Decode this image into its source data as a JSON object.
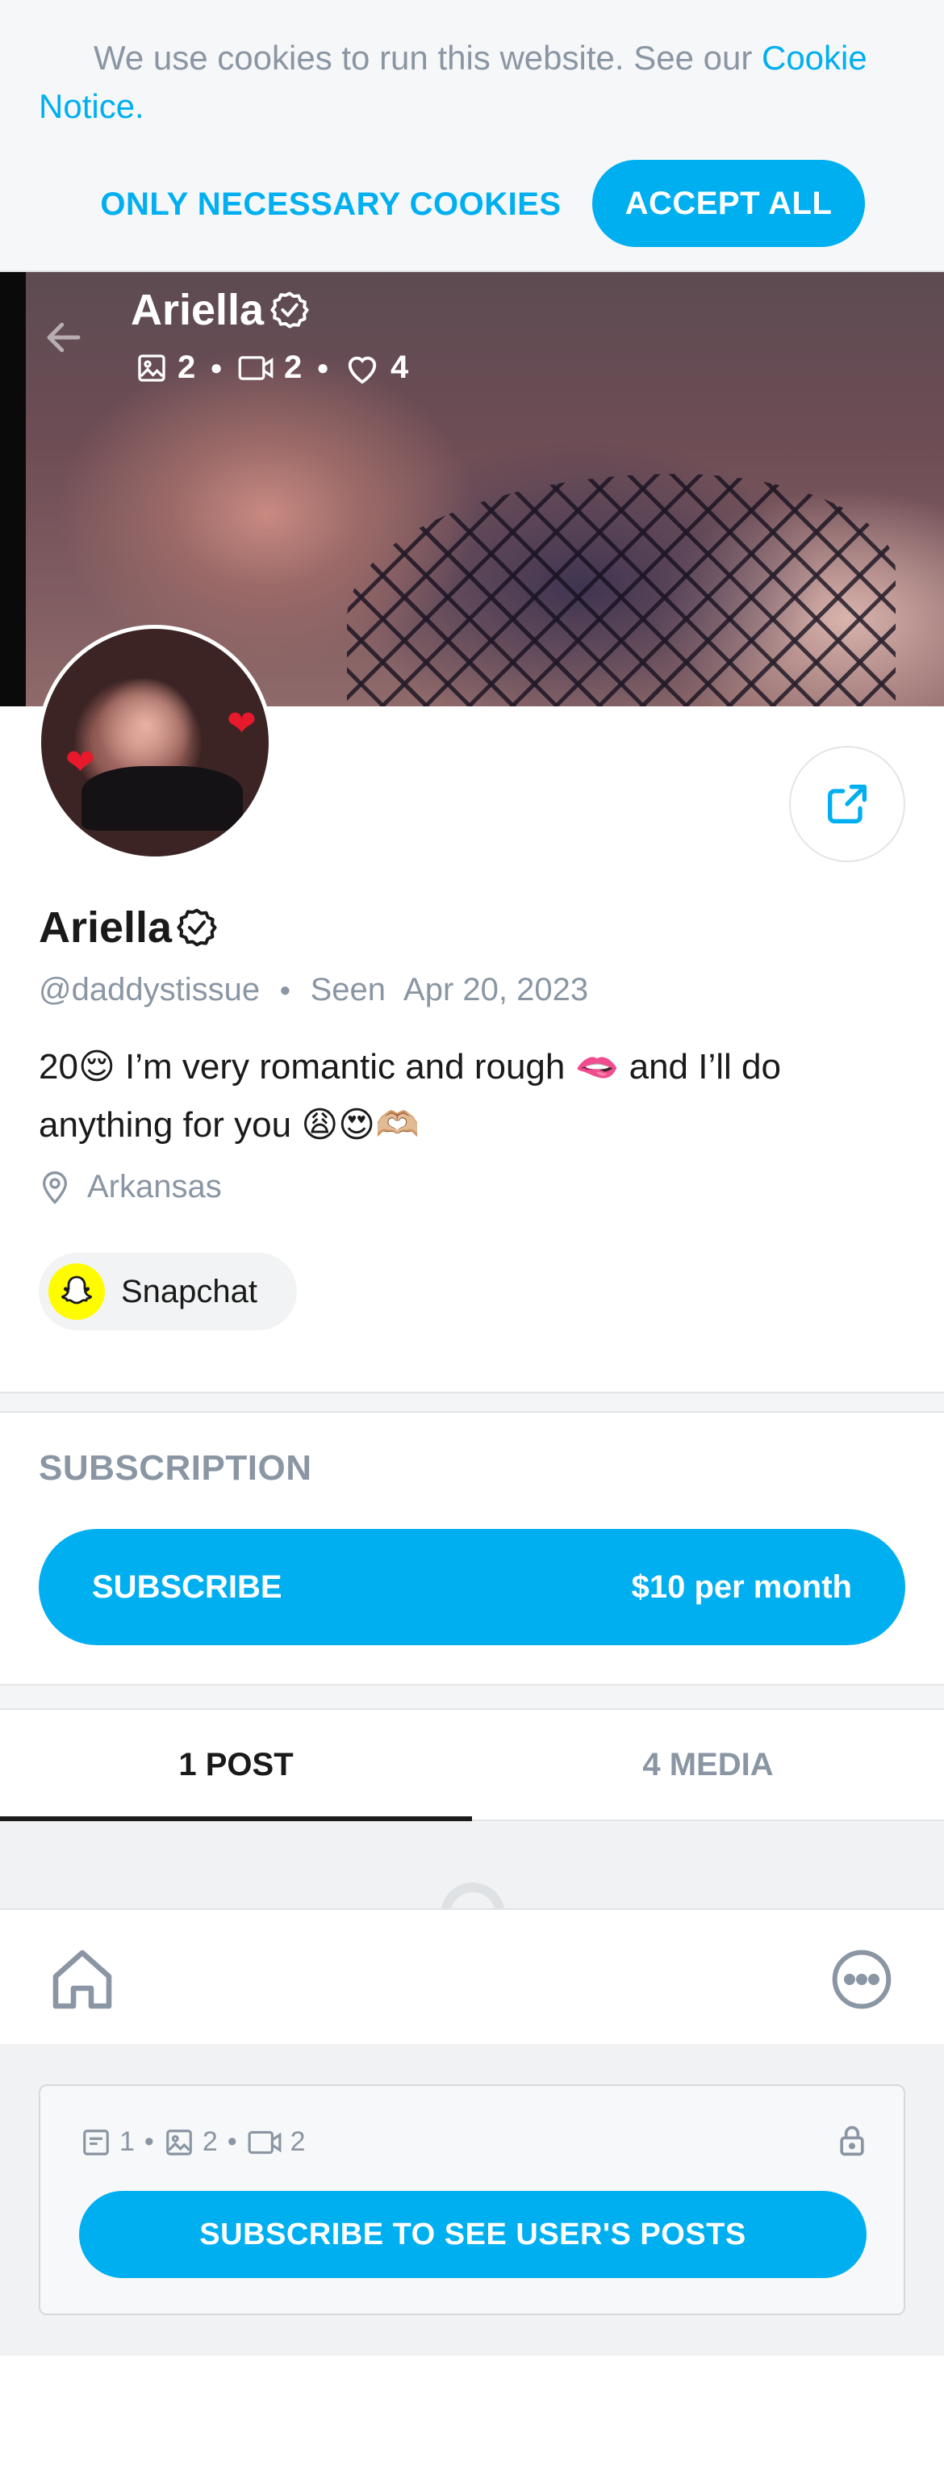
{
  "cookie_banner": {
    "text": "We use cookies to run this website. See our ",
    "link": "Cookie Notice.",
    "necessary_label": "ONLY NECESSARY COOKIES",
    "accept_label": "ACCEPT ALL"
  },
  "cover": {
    "name": "Ariella",
    "photos": "2",
    "videos": "2",
    "likes": "4"
  },
  "profile": {
    "name": "Ariella",
    "username": "@daddystissue",
    "seen_label": "Seen",
    "seen_date": "Apr 20, 2023",
    "bio": "20😌 I’m very romantic and rough 🫦 and I’ll do anything for you 😩😍🫶🏼",
    "location": "Arkansas",
    "social_label": "Snapchat"
  },
  "subscription": {
    "title": "SUBSCRIPTION",
    "button_label": "SUBSCRIBE",
    "price": "$10 per month"
  },
  "tabs": [
    {
      "label": "1 POST",
      "active": true
    },
    {
      "label": "4 MEDIA",
      "active": false
    }
  ],
  "locked": {
    "posts": "1",
    "photos": "2",
    "videos": "2",
    "button_label": "SUBSCRIBE TO SEE USER'S POSTS"
  },
  "colors": {
    "accent": "#00aff0",
    "muted": "#8a96a3",
    "text": "#1a1a1a"
  },
  "icons": [
    "back-arrow-icon",
    "verified-icon",
    "image-icon",
    "video-icon",
    "heart-icon",
    "share-icon",
    "location-pin-icon",
    "snapchat-icon",
    "home-icon",
    "more-icon",
    "text-post-icon",
    "lock-icon"
  ]
}
